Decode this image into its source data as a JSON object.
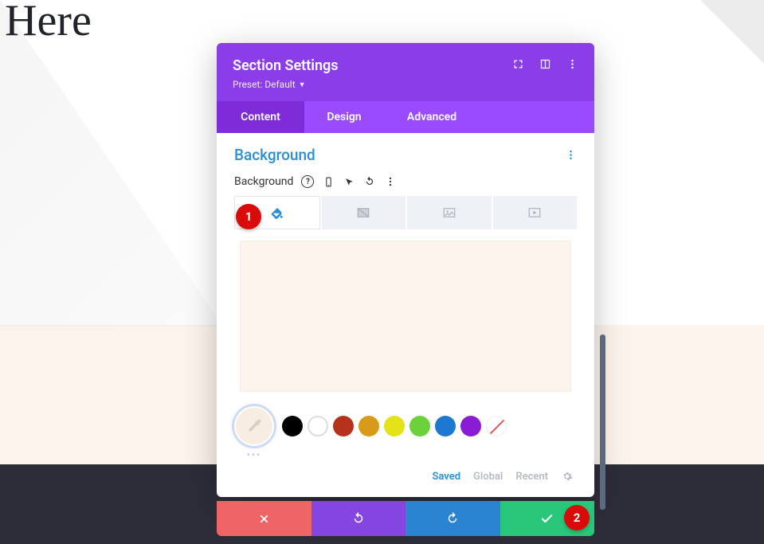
{
  "hero_text": "Here",
  "modal": {
    "title": "Section Settings",
    "preset_label": "Preset: Default",
    "tabs": [
      "Content",
      "Design",
      "Advanced"
    ],
    "active_tab": "Content",
    "section_title": "Background",
    "field_label": "Background",
    "preview_color": "#fcf4ec",
    "swatches": [
      "#000000",
      "outline",
      "#b7321d",
      "#d89a18",
      "#e4e219",
      "#6bd23b",
      "#1d78d1",
      "#8a1dd4",
      "none"
    ],
    "palette_tabs": {
      "saved": "Saved",
      "global": "Global",
      "recent": "Recent",
      "active": "Saved"
    }
  },
  "markers": {
    "m1": "1",
    "m2": "2"
  }
}
